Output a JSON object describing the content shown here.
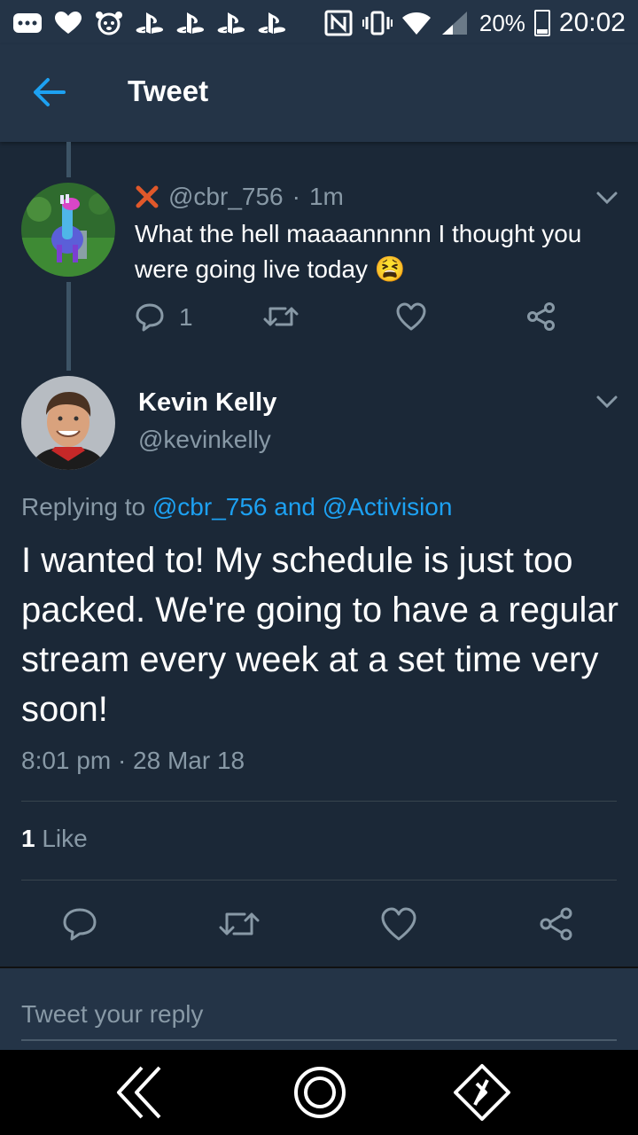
{
  "status_bar": {
    "battery_percent": "20%",
    "time": "20:02",
    "icons": [
      "more-icon",
      "heart-icon",
      "dog-icon",
      "playstation-icon",
      "playstation-icon",
      "playstation-icon",
      "playstation-icon",
      "nfc-icon",
      "vibrate-icon",
      "wifi-icon",
      "signal-icon",
      "battery-charging-icon"
    ]
  },
  "header": {
    "title": "Tweet",
    "back_icon": "back-arrow-icon"
  },
  "parent_tweet": {
    "handle": "@cbr_756",
    "separator": "·",
    "time": "1m",
    "text": "What the hell maaaannnnn I thought you were going live today",
    "emoji": "😫",
    "reply_count": "1"
  },
  "main_tweet": {
    "name": "Kevin Kelly",
    "handle": "@kevinkelly",
    "replying_prefix": "Replying to",
    "replying_user1": "@cbr_756",
    "replying_and": "and",
    "replying_user2": "@Activision",
    "text": "I wanted to! My schedule is just too packed. We're going to have a regular stream every week at a set time very soon!",
    "timestamp": "8:01 pm · 28 Mar 18",
    "likes_count": "1",
    "likes_label": "Like"
  },
  "reply": {
    "placeholder": "Tweet your reply"
  },
  "colors": {
    "background": "#1b2837",
    "header": "#243447",
    "accent": "#1da1f2",
    "muted": "#8899a6",
    "x_mark": "#e0582a"
  }
}
